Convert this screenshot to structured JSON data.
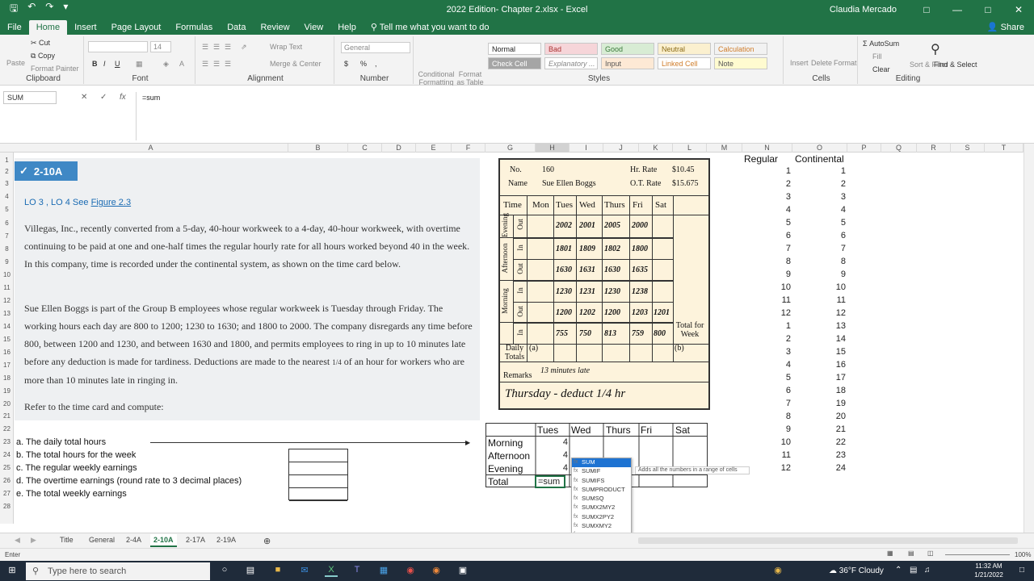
{
  "window": {
    "doc_title": "2022 Edition- Chapter 2.xlsx  -  Excel",
    "user": "Claudia Mercado"
  },
  "menu": {
    "tabs": [
      "File",
      "Home",
      "Insert",
      "Page Layout",
      "Formulas",
      "Data",
      "Review",
      "View",
      "Help"
    ],
    "tell_me": "Tell me what you want to do",
    "share": "Share"
  },
  "ribbon": {
    "clipboard": {
      "paste": "Paste",
      "cut": "Cut",
      "copy": "Copy",
      "format_painter": "Format Painter",
      "label": "Clipboard"
    },
    "font": {
      "size": "14",
      "label": "Font"
    },
    "alignment": {
      "wrap": "Wrap Text",
      "merge": "Merge & Center",
      "label": "Alignment"
    },
    "number": {
      "format": "General",
      "label": "Number"
    },
    "styles": {
      "cond": "Conditional Formatting",
      "fmt_table": "Format as Table",
      "normal": "Normal",
      "bad": "Bad",
      "good": "Good",
      "neutral": "Neutral",
      "calculation": "Calculation",
      "check_cell": "Check Cell",
      "explanatory": "Explanatory ...",
      "input": "Input",
      "linked_cell": "Linked Cell",
      "note": "Note",
      "label": "Styles"
    },
    "cells": {
      "insert": "Insert",
      "delete": "Delete",
      "format": "Format",
      "label": "Cells"
    },
    "editing": {
      "autosum": "AutoSum",
      "fill": "Fill",
      "clear": "Clear",
      "sort": "Sort & Filter",
      "find": "Find & Select",
      "label": "Editing"
    }
  },
  "formula_bar": {
    "name_box": "SUM",
    "formula": "=sum"
  },
  "columns": [
    "A",
    "B",
    "C",
    "D",
    "E",
    "F",
    "G",
    "H",
    "I",
    "J",
    "K",
    "L",
    "M",
    "N",
    "O",
    "P",
    "Q",
    "R",
    "S",
    "T"
  ],
  "rows": [
    "1",
    "2",
    "3",
    "4",
    "5",
    "6",
    "7",
    "8",
    "9",
    "10",
    "11",
    "12",
    "13",
    "14",
    "15",
    "16",
    "17",
    "18",
    "19",
    "20",
    "21",
    "22",
    "23",
    "24",
    "25",
    "26",
    "27",
    "28"
  ],
  "problem": {
    "badge": "2-10A",
    "lo": "LO 3 ,  LO 4  See ",
    "figure_link": "Figure 2.3",
    "para1": "Villegas, Inc., recently converted from a 5-day, 40-hour workweek to a 4-day, 40-hour workweek, with overtime continuing to be paid at one and one-half times the regular hourly rate for all hours worked beyond 40 in the week. In this company, time is recorded under the continental system, as shown on the time card below.",
    "para2a": "Sue Ellen Boggs is part of the Group B employees whose regular workweek is Tuesday through Friday. The working hours each day are 800 to 1200; 1230 to 1630; and 1800 to 2000. The company disregards any time before 800, between 1200 and 1230, and between 1630 and 1800, and permits employees to ring in up to 10 minutes late before any deduction is made for tardiness. Deductions are made to the nearest ",
    "fraction": "1/4",
    "para2b": " of an hour for workers who are more than 10 minutes late in ringing in.",
    "refer": "Refer to the time card and compute:"
  },
  "timecard": {
    "no_label": "No.",
    "no": "160",
    "name_label": "Name",
    "name": "Sue Ellen Boggs",
    "hr_rate_label": "Hr. Rate",
    "hr_rate": "$10.45",
    "ot_rate_label": "O.T. Rate",
    "ot_rate": "$15.675",
    "days": [
      "Time",
      "Mon",
      "Tues",
      "Wed",
      "Thurs",
      "Fri",
      "Sat"
    ],
    "sections": [
      "Evening",
      "Afternoon",
      "Morning"
    ],
    "inout": [
      "Out",
      "In",
      "Out",
      "In",
      "Out",
      "In"
    ],
    "rows": [
      [
        "",
        "2002",
        "2001",
        "2005",
        "2000",
        ""
      ],
      [
        "",
        "1801",
        "1809",
        "1802",
        "1800",
        ""
      ],
      [
        "",
        "1630",
        "1631",
        "1630",
        "1635",
        ""
      ],
      [
        "",
        "1230",
        "1231",
        "1230",
        "1238",
        ""
      ],
      [
        "",
        "1200",
        "1202",
        "1200",
        "1203",
        "1201"
      ],
      [
        "",
        "755",
        "750",
        "813",
        "759",
        "800"
      ]
    ],
    "total_week": "Total for Week",
    "daily_totals": "Daily Totals",
    "a": "(a)",
    "b": "(b)",
    "remarks": "Remarks",
    "hw1": "13 minutes late",
    "hw2": "Thursday - deduct 1/4 hr"
  },
  "questions": [
    "a. The daily total hours",
    "b. The total hours for the week",
    "c. The regular weekly earnings",
    "d. The overtime earnings (round rate to 3 decimal places)",
    "e. The total weekly earnings"
  ],
  "table": {
    "headers": [
      "Tues",
      "Wed",
      "Thurs",
      "Fri",
      "Sat"
    ],
    "rows": [
      {
        "label": "Morning",
        "tues": "4"
      },
      {
        "label": "Afternoon",
        "tues": "4"
      },
      {
        "label": "Evening",
        "tues": "4"
      },
      {
        "label": "Total",
        "tues": "=sum"
      }
    ]
  },
  "conversion": {
    "h1": "Regular",
    "h2": "Continental",
    "regular": [
      "1",
      "2",
      "3",
      "4",
      "5",
      "6",
      "7",
      "8",
      "9",
      "10",
      "11",
      "12",
      "1",
      "2",
      "3",
      "4",
      "5",
      "6",
      "7",
      "8",
      "9",
      "10",
      "11",
      "12"
    ],
    "continental": [
      "1",
      "2",
      "3",
      "4",
      "5",
      "6",
      "7",
      "8",
      "9",
      "10",
      "11",
      "12",
      "13",
      "14",
      "15",
      "16",
      "17",
      "18",
      "19",
      "20",
      "21",
      "22",
      "23",
      "24"
    ]
  },
  "autocomplete": {
    "items": [
      "SUM",
      "SUMIF",
      "SUMIFS",
      "SUMPRODUCT",
      "SUMSQ",
      "SUMX2MY2",
      "SUMX2PY2",
      "SUMXMY2",
      "DSUM",
      "IMSUM",
      "SERIESSUM"
    ],
    "tooltip": "Adds all the numbers in a range of cells"
  },
  "sheets": [
    "Title",
    "General",
    "2-4A",
    "2-10A",
    "2-17A",
    "2-19A"
  ],
  "status": {
    "mode": "Enter",
    "zoom": "100%"
  },
  "taskbar": {
    "search": "Type here to search",
    "weather": "36°F  Cloudy",
    "time": "11:32 AM",
    "date": "1/21/2022"
  }
}
